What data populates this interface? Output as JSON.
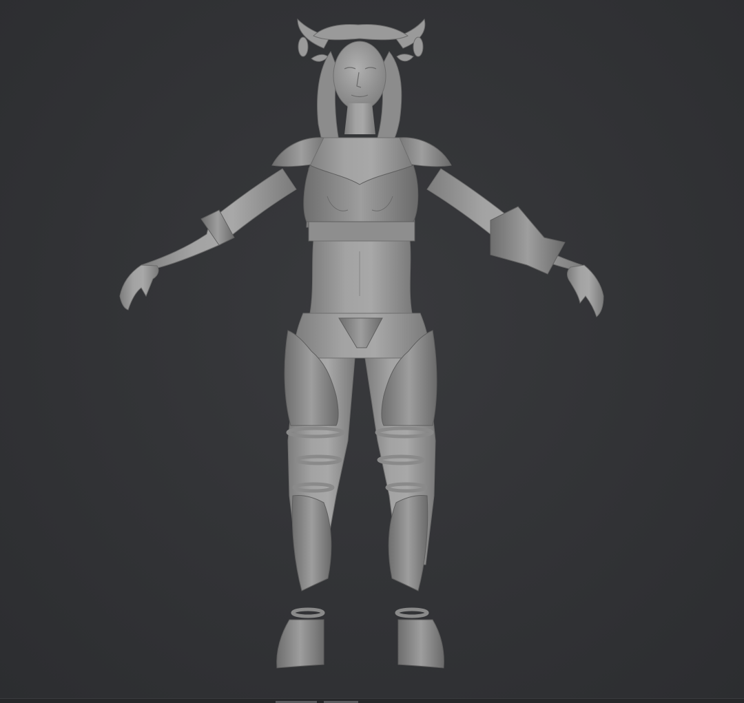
{
  "viewport": {
    "background_color": "#333437",
    "shading": "solid-matcap-grey",
    "model_color": "#9b9b9b"
  },
  "model": {
    "subject": "sculpted-female-character-t-pose",
    "pose": "a-pose"
  }
}
